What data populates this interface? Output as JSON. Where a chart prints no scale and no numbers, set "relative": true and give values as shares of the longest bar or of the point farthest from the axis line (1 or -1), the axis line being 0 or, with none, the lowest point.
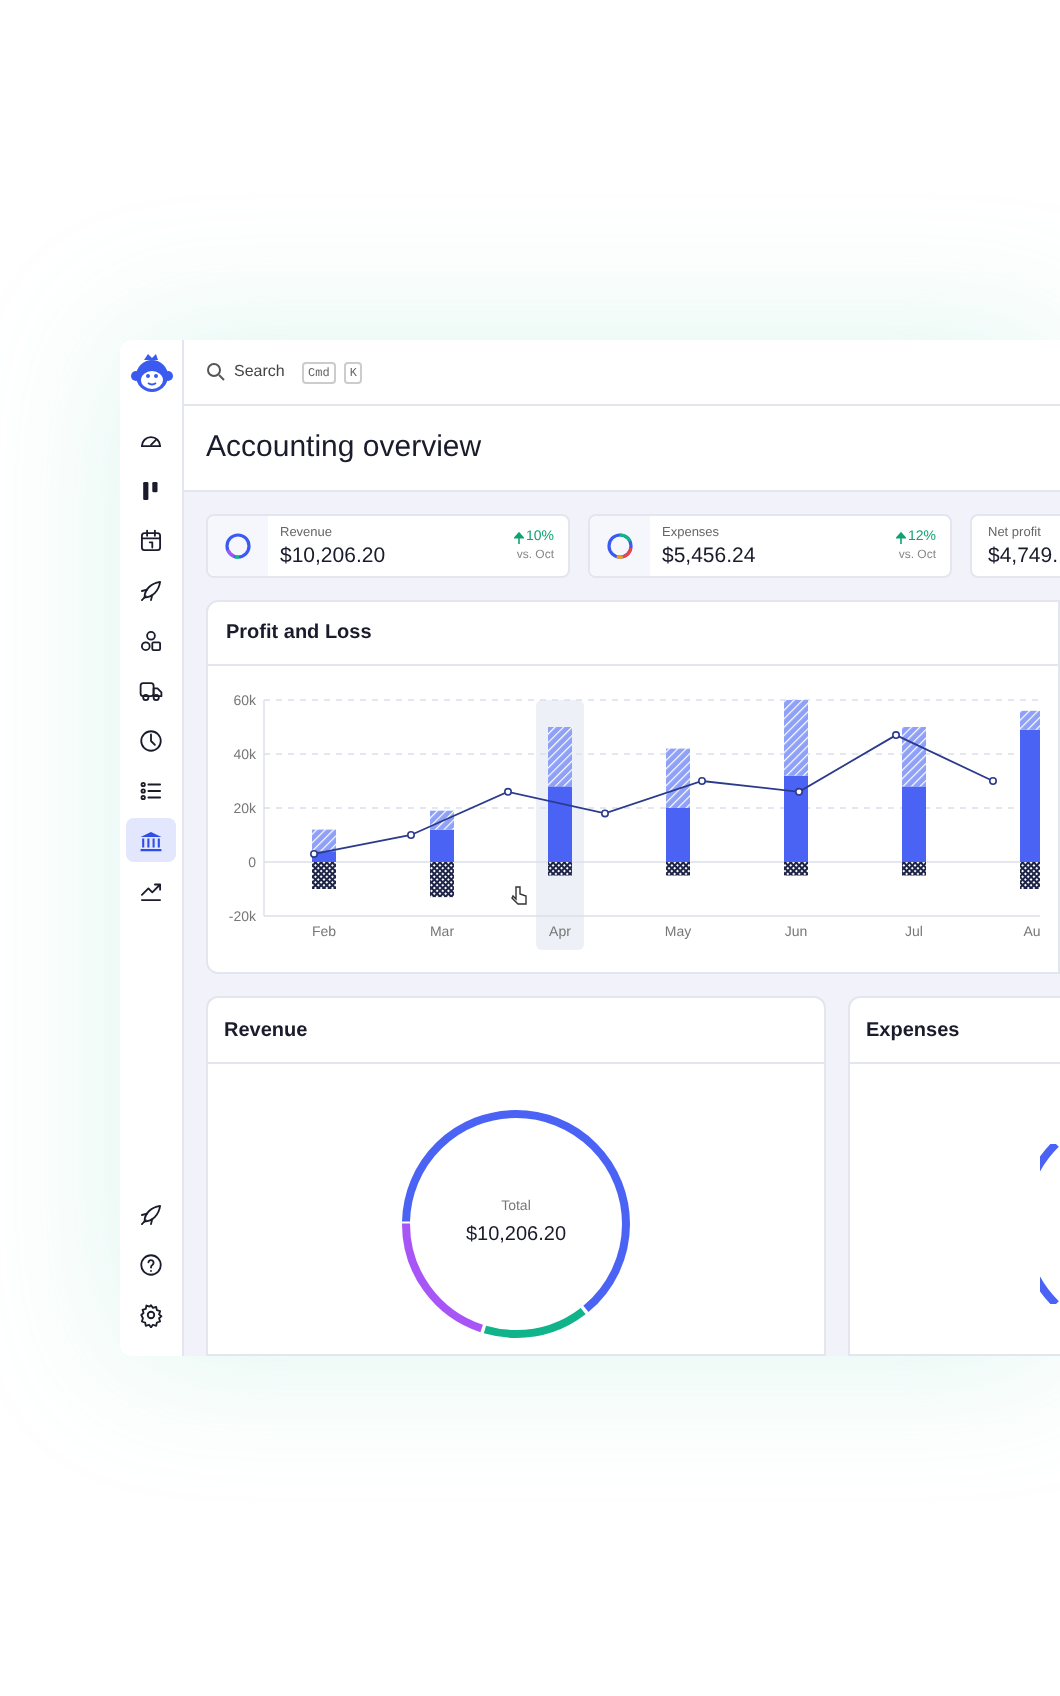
{
  "search": {
    "placeholder": "Search",
    "keys": [
      "Cmd",
      "K"
    ]
  },
  "sidebar": {
    "items": [
      {
        "selected": false
      },
      {
        "selected": false
      },
      {
        "selected": false
      },
      {
        "selected": false
      },
      {
        "selected": false
      },
      {
        "selected": false
      },
      {
        "selected": false
      },
      {
        "selected": false
      },
      {
        "selected": true
      },
      {
        "selected": false
      }
    ],
    "footer_items": [
      {
        "selected": false
      },
      {
        "selected": false
      },
      {
        "selected": false
      }
    ]
  },
  "page_title": "Accounting overview",
  "kpis": [
    {
      "label": "Revenue",
      "value": "$10,206.20",
      "change": "10%",
      "comparison": "vs. Oct"
    },
    {
      "label": "Expenses",
      "value": "$5,456.24",
      "change": "12%",
      "comparison": "vs. Oct"
    },
    {
      "label": "Net profit",
      "value": "$4,749."
    }
  ],
  "profit_and_loss": {
    "title": "Profit and Loss",
    "columns": [
      {
        "selected": false
      },
      {
        "selected": false
      },
      {
        "selected": true
      },
      {
        "selected": false
      },
      {
        "selected": false
      },
      {
        "selected": false
      },
      {
        "selected": false
      }
    ],
    "chart_data": {
      "type": "bar",
      "stacked": true,
      "categories": [
        "Feb",
        "Mar",
        "Apr",
        "May",
        "Jun",
        "Jul",
        "Au"
      ],
      "ylim": [
        -20,
        60
      ],
      "yticks": [
        {
          "value": 60,
          "label": "60k"
        },
        {
          "value": 40,
          "label": "40k"
        },
        {
          "value": 20,
          "label": "20k"
        },
        {
          "value": 0,
          "label": "0"
        },
        {
          "value": -20,
          "label": "-20k"
        }
      ],
      "series": [
        {
          "color": "#4a63f5",
          "values": [
            4,
            12,
            28,
            20,
            32,
            28,
            49
          ]
        },
        {
          "color": "#8fa0f7",
          "values": [
            8,
            7,
            22,
            22,
            28,
            22,
            7
          ]
        },
        {
          "color": "#1e2447",
          "values": [
            -10,
            -13,
            -5,
            -5,
            -5,
            -5,
            -10
          ]
        }
      ]
    },
    "trend": {
      "chart_data": {
        "type": "line",
        "relative": true,
        "ylim": [
          -20,
          60
        ],
        "series": [
          {
            "color": "#2b3a8c",
            "marker": "circle",
            "values": [
              3,
              10,
              26,
              18,
              30,
              26,
              47,
              30
            ]
          }
        ]
      }
    }
  },
  "revenue": {
    "title": "Revenue",
    "total_label": "Total",
    "total": "$10,206.20"
  },
  "expenses": {
    "title": "Expenses"
  }
}
